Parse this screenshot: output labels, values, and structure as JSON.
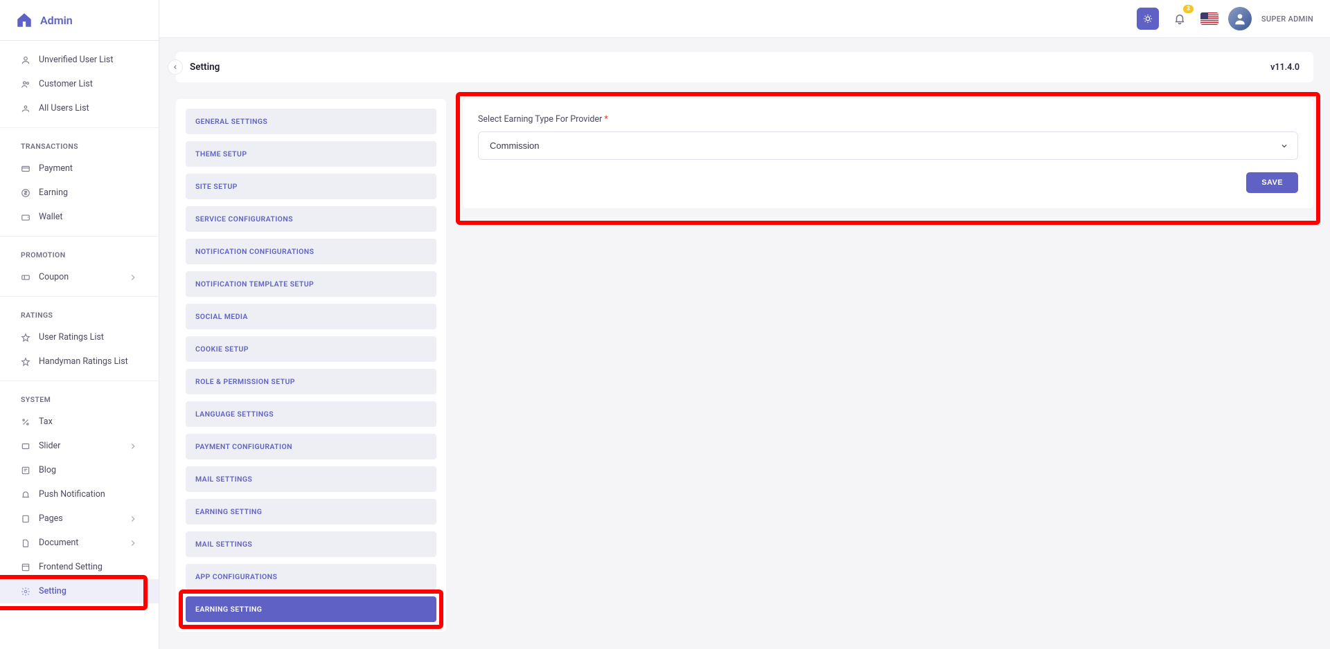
{
  "brand": {
    "name": "Admin"
  },
  "topbar": {
    "badge_count": "3",
    "user_label": "SUPER ADMIN"
  },
  "page": {
    "title": "Setting",
    "version": "v11.4.0"
  },
  "sidebar": {
    "top_items": [
      {
        "label": "Unverified User List"
      },
      {
        "label": "Customer List"
      },
      {
        "label": "All Users List"
      }
    ],
    "transactions_heading": "TRANSACTIONS",
    "transactions": [
      {
        "label": "Payment"
      },
      {
        "label": "Earning"
      },
      {
        "label": "Wallet"
      }
    ],
    "promotion_heading": "PROMOTION",
    "promotion": [
      {
        "label": "Coupon",
        "has_children": true
      }
    ],
    "ratings_heading": "RATINGS",
    "ratings": [
      {
        "label": "User Ratings List"
      },
      {
        "label": "Handyman Ratings List"
      }
    ],
    "system_heading": "SYSTEM",
    "system": [
      {
        "label": "Tax"
      },
      {
        "label": "Slider",
        "has_children": true
      },
      {
        "label": "Blog"
      },
      {
        "label": "Push Notification"
      },
      {
        "label": "Pages",
        "has_children": true
      },
      {
        "label": "Document",
        "has_children": true
      },
      {
        "label": "Frontend Setting"
      },
      {
        "label": "Setting",
        "active": true
      }
    ]
  },
  "settings_tabs": [
    "GENERAL SETTINGS",
    "THEME SETUP",
    "SITE SETUP",
    "SERVICE CONFIGURATIONS",
    "NOTIFICATION CONFIGURATIONS",
    "NOTIFICATION TEMPLATE SETUP",
    "SOCIAL MEDIA",
    "COOKIE SETUP",
    "ROLE & PERMISSION SETUP",
    "LANGUAGE SETTINGS",
    "PAYMENT CONFIGURATION",
    "MAIL SETTINGS",
    "EARNING SETTING",
    "MAIL SETTINGS",
    "APP CONFIGURATIONS",
    "EARNING SETTING"
  ],
  "settings_active_index": 15,
  "form": {
    "label": "Select Earning Type For Provider",
    "value": "Commission",
    "save": "SAVE"
  }
}
